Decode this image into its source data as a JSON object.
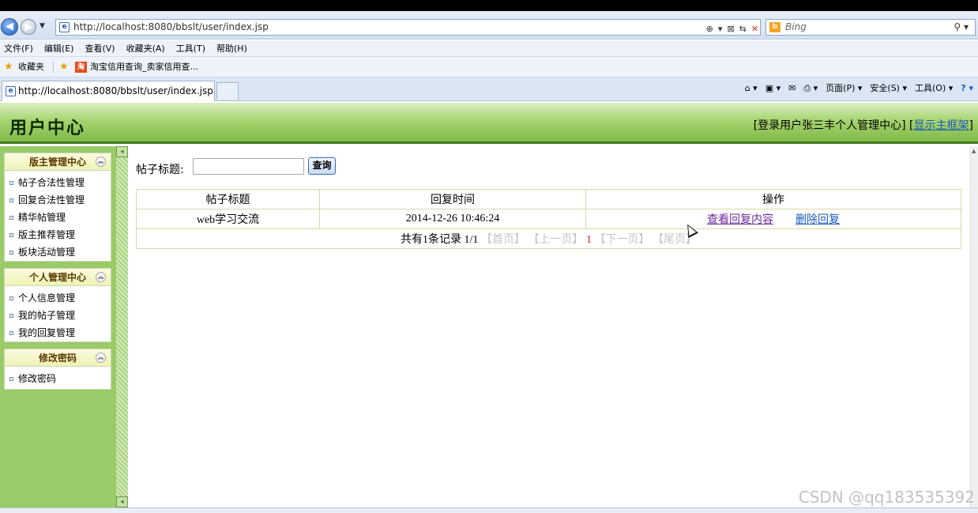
{
  "browser": {
    "url": "http://localhost:8080/bbslt/user/index.jsp",
    "search_placeholder": "Bing",
    "menu": [
      "文件(F)",
      "编辑(E)",
      "查看(V)",
      "收藏夹(A)",
      "工具(T)",
      "帮助(H)"
    ],
    "favorites_label": "收藏夹",
    "favorite_link": "淘宝信用查询_卖家信用查...",
    "tab_title": "http://localhost:8080/bbslt/user/index.jsp",
    "commands": [
      "页面(P) ▾",
      "安全(S) ▾",
      "工具(O) ▾"
    ]
  },
  "header": {
    "title": "用户中心",
    "user_info_prefix": "[登录用户张三丰个人管理中心] [",
    "main_frame_link": "显示主框架",
    "user_info_suffix": "]"
  },
  "sidebar": {
    "panels": [
      {
        "title": "版主管理中心",
        "items": [
          "帖子合法性管理",
          "回复合法性管理",
          "精华帖管理",
          "版主推荐管理",
          "板块活动管理"
        ]
      },
      {
        "title": "个人管理中心",
        "items": [
          "个人信息管理",
          "我的帖子管理",
          "我的回复管理"
        ]
      },
      {
        "title": "修改密码",
        "items": [
          "修改密码"
        ]
      }
    ]
  },
  "search": {
    "label": "帖子标题:",
    "value": "",
    "button": "查询"
  },
  "table": {
    "headers": [
      "帖子标题",
      "回复时间",
      "操作"
    ],
    "rows": [
      {
        "title": "web学习交流",
        "time": "2014-12-26 10:46:24",
        "view_link": "查看回复内容",
        "delete_link": "删除回复"
      }
    ],
    "pager": {
      "summary": "共有1条记录  1/1",
      "first": "【首页】",
      "prev": "【上一页】",
      "current": "1",
      "next": "【下一页】",
      "last": "【尾页】"
    }
  },
  "watermark": "CSDN @qq183535392"
}
